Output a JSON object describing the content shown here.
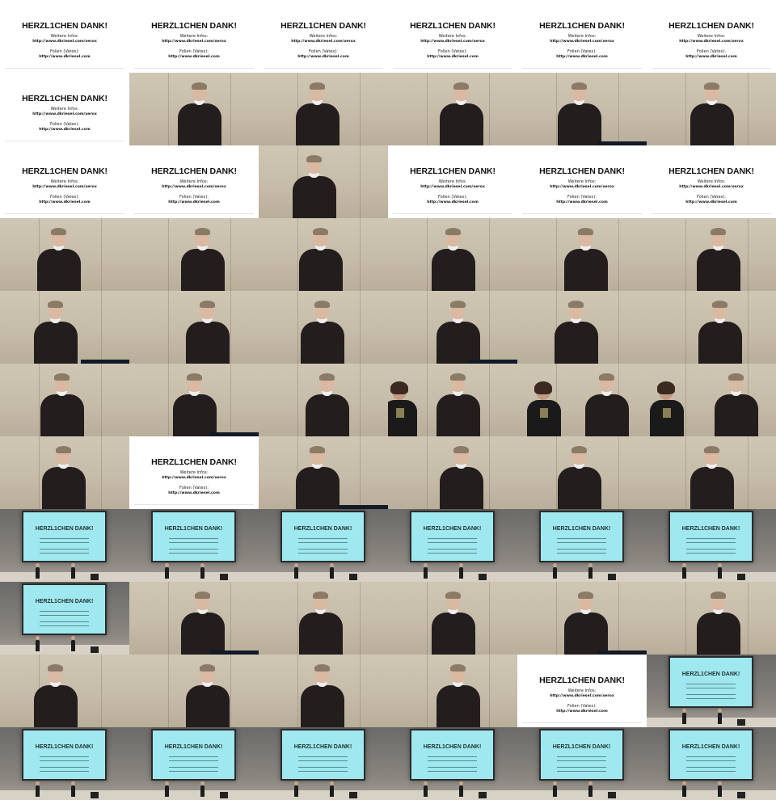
{
  "slide": {
    "title": "HERZL1CHEN DANK!",
    "line1": "Weitere Infos:",
    "url1": "http://www.dkriesel.com/xerox",
    "line2": "Folien (Vatex):",
    "url2": "http://www.dkriesel.com"
  },
  "screen_title": "HERZL1CHEN DANK!",
  "grid": {
    "columns": 6,
    "rows": 11
  },
  "frames": [
    "slide",
    "slide",
    "slide",
    "slide",
    "slide",
    "slide",
    "slide",
    "speaker",
    "speaker",
    "speaker",
    "speaker",
    "speaker",
    "slide",
    "slide",
    "speaker",
    "slide",
    "slide",
    "slide",
    "speaker",
    "speaker",
    "speaker",
    "speaker",
    "speaker",
    "speaker",
    "speaker",
    "speaker",
    "speaker",
    "speaker",
    "speaker",
    "speaker",
    "speaker",
    "speaker",
    "speaker",
    "speaker-woman",
    "woman-speaker",
    "woman-speaker",
    "speaker",
    "slide",
    "speaker",
    "speaker",
    "speaker",
    "speaker",
    "stage",
    "stage",
    "stage",
    "stage",
    "stage",
    "stage",
    "stage",
    "speaker",
    "speaker",
    "speaker",
    "speaker",
    "speaker",
    "speaker",
    "speaker",
    "speaker",
    "speaker",
    "slide",
    "stage",
    "stage",
    "stage",
    "stage",
    "stage",
    "stage",
    "stage"
  ]
}
